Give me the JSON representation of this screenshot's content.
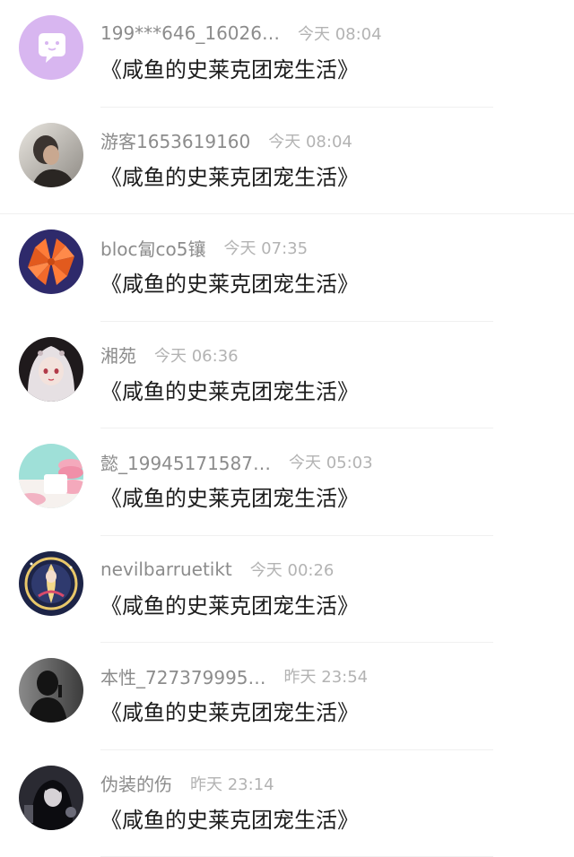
{
  "comments": [
    {
      "name": "199***646_16026…",
      "time": "今天 08:04",
      "text": "《咸鱼的史莱克团宠生活》",
      "avatar_icon": "chat-bubble-icon",
      "avatar_color": "#d8b6f0"
    },
    {
      "name": "游客1653619160",
      "time": "今天 08:04",
      "text": "《咸鱼的史莱克团宠生活》",
      "avatar_icon": "user-photo",
      "avatar_color": "#b9b4ac"
    },
    {
      "name": "bloc匐co5镶",
      "time": "今天 07:35",
      "text": "《咸鱼的史莱克团宠生活》",
      "avatar_icon": "origami-flower",
      "avatar_color": "#2e2a6b"
    },
    {
      "name": "湘苑",
      "time": "今天 06:36",
      "text": "《咸鱼的史莱克团宠生活》",
      "avatar_icon": "anime-girl",
      "avatar_color": "#d9d3d6"
    },
    {
      "name": "懿_19945171587…",
      "time": "今天 05:03",
      "text": "《咸鱼的史莱克团宠生活》",
      "avatar_icon": "macaron-photo",
      "avatar_color": "#9fe0d8"
    },
    {
      "name": "nevilbarruetikt",
      "time": "今天 00:26",
      "text": "《咸鱼的史莱克团宠生活》",
      "avatar_icon": "anime-moon",
      "avatar_color": "#1d2447"
    },
    {
      "name": "本性_727379995…",
      "time": "昨天 23:54",
      "text": "《咸鱼的史莱克团宠生活》",
      "avatar_icon": "silhouette",
      "avatar_color": "#5e5e5e"
    },
    {
      "name": "伪装的伤",
      "time": "昨天 23:14",
      "text": "《咸鱼的史莱克团宠生活》",
      "avatar_icon": "dark-girl",
      "avatar_color": "#2a2a32"
    }
  ]
}
